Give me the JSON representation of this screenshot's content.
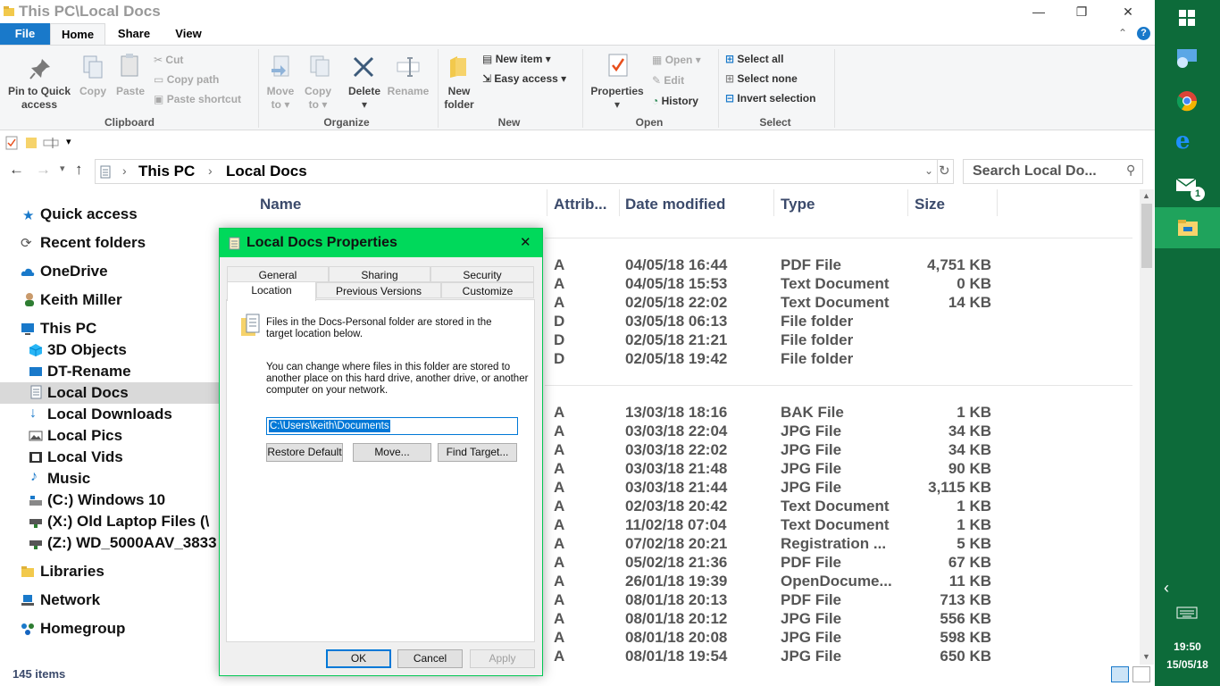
{
  "window": {
    "title": "This PC\\Local Docs",
    "min": "—",
    "restore": "❐",
    "close": "✕"
  },
  "tabs": {
    "file": "File",
    "home": "Home",
    "share": "Share",
    "view": "View",
    "help": "?"
  },
  "ribbon": {
    "clipboard": {
      "label": "Clipboard",
      "pin_line1": "Pin to Quick",
      "pin_line2": "access",
      "copy": "Copy",
      "paste": "Paste",
      "cut": "Cut",
      "copy_path": "Copy path",
      "paste_shortcut": "Paste shortcut"
    },
    "organize": {
      "label": "Organize",
      "move_to_line1": "Move",
      "move_to_line2": "to",
      "copy_to_line1": "Copy",
      "copy_to_line2": "to",
      "delete": "Delete",
      "rename": "Rename"
    },
    "new": {
      "label": "New",
      "new_folder_line1": "New",
      "new_folder_line2": "folder",
      "new_item": "New item",
      "easy_access": "Easy access"
    },
    "open": {
      "label": "Open",
      "properties": "Properties",
      "open": "Open",
      "edit": "Edit",
      "history": "History"
    },
    "select": {
      "label": "Select",
      "select_all": "Select all",
      "select_none": "Select none",
      "invert": "Invert selection"
    }
  },
  "address": {
    "path": [
      "This PC",
      "Local Docs"
    ],
    "search_placeholder": "Search Local Do..."
  },
  "nav": {
    "quick_access": "Quick access",
    "recent_folders": "Recent folders",
    "onedrive": "OneDrive",
    "user": "Keith Miller",
    "this_pc": "This PC",
    "children": [
      "3D Objects",
      "DT-Rename",
      "Local Docs",
      "Local Downloads",
      "Local Pics",
      "Local Vids",
      "Music",
      "(C:) Windows 10",
      "(X:) Old Laptop Files (\\",
      "(Z:) WD_5000AAV_3833"
    ],
    "libraries": "Libraries",
    "network": "Network",
    "homegroup": "Homegroup"
  },
  "columns": {
    "name": "Name",
    "attrib": "Attrib...",
    "date": "Date modified",
    "type": "Type",
    "size": "Size"
  },
  "files_group1": [
    {
      "attr": "A",
      "date": "04/05/18 16:44",
      "type": "PDF File",
      "size": "4,751 KB"
    },
    {
      "attr": "A",
      "date": "04/05/18 15:53",
      "type": "Text Document",
      "size": "0 KB"
    },
    {
      "attr": "A",
      "date": "02/05/18 22:02",
      "type": "Text Document",
      "size": "14 KB"
    },
    {
      "attr": "D",
      "date": "03/05/18 06:13",
      "type": "File folder",
      "size": ""
    },
    {
      "attr": "D",
      "date": "02/05/18 21:21",
      "type": "File folder",
      "size": ""
    },
    {
      "attr": "D",
      "date": "02/05/18 19:42",
      "type": "File folder",
      "size": ""
    }
  ],
  "files_group2": [
    {
      "attr": "A",
      "date": "13/03/18 18:16",
      "type": "BAK File",
      "size": "1 KB"
    },
    {
      "attr": "A",
      "date": "03/03/18 22:04",
      "type": "JPG File",
      "size": "34 KB"
    },
    {
      "attr": "A",
      "date": "03/03/18 22:02",
      "type": "JPG File",
      "size": "34 KB"
    },
    {
      "attr": "A",
      "date": "03/03/18 21:48",
      "type": "JPG File",
      "size": "90 KB"
    },
    {
      "attr": "A",
      "date": "03/03/18 21:44",
      "type": "JPG File",
      "size": "3,115 KB"
    },
    {
      "attr": "A",
      "date": "02/03/18 20:42",
      "type": "Text Document",
      "size": "1 KB"
    },
    {
      "attr": "A",
      "date": "11/02/18 07:04",
      "type": "Text Document",
      "size": "1 KB"
    },
    {
      "attr": "A",
      "date": "07/02/18 20:21",
      "type": "Registration ...",
      "size": "5 KB"
    },
    {
      "attr": "A",
      "date": "05/02/18 21:36",
      "type": "PDF File",
      "size": "67 KB"
    },
    {
      "attr": "A",
      "date": "26/01/18 19:39",
      "type": "OpenDocume...",
      "size": "11 KB"
    },
    {
      "attr": "A",
      "date": "08/01/18 20:13",
      "type": "PDF File",
      "size": "713 KB"
    },
    {
      "attr": "A",
      "date": "08/01/18 20:12",
      "type": "JPG File",
      "size": "556 KB"
    },
    {
      "attr": "A",
      "date": "08/01/18 20:08",
      "type": "JPG File",
      "size": "598 KB"
    },
    {
      "attr": "A",
      "date": "08/01/18 19:54",
      "type": "JPG File",
      "size": "650 KB"
    }
  ],
  "status": {
    "items": "145 items"
  },
  "dialog": {
    "title": "Local Docs Properties",
    "tabs_row1": [
      "General",
      "Sharing",
      "Security"
    ],
    "tabs_row2": [
      "Location",
      "Previous Versions",
      "Customize"
    ],
    "info_line1": "Files in the Docs-Personal folder are stored in the",
    "info_line2": "target location below.",
    "change_line1": "You can change where files in this folder are stored to",
    "change_line2": "another place on this hard drive, another drive, or another",
    "change_line3": "computer on your network.",
    "path_value": "C:\\Users\\keith\\Documents",
    "restore_default": "Restore Default",
    "move": "Move...",
    "find_target": "Find Target...",
    "ok": "OK",
    "cancel": "Cancel",
    "apply": "Apply"
  },
  "taskbar": {
    "time": "19:50",
    "date": "15/05/18",
    "mail_badge": "1"
  },
  "colors": {
    "accent": "#1979ca",
    "dialog_title": "#00d95b",
    "taskbar": "#0d6b3a"
  }
}
